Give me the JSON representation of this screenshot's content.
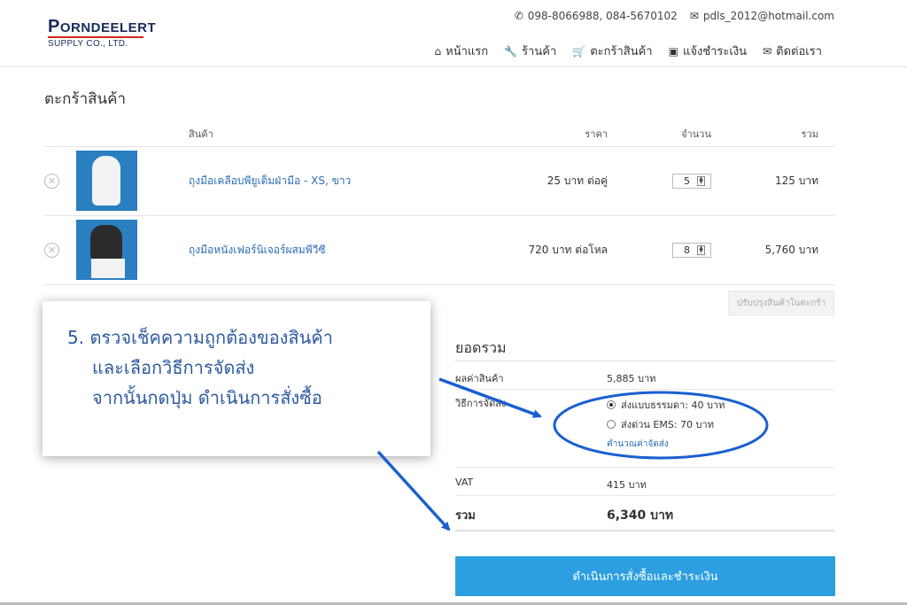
{
  "header": {
    "logo_main_first": "P",
    "logo_main_rest": "ORNDEELERT",
    "logo_sub": "SUPPLY  CO., LTD.",
    "phone": "098-8066988, 084-5670102",
    "email": "pdls_2012@hotmail.com",
    "nav": [
      {
        "label": "หน้าแรก",
        "icon": "home-icon"
      },
      {
        "label": "ร้านค้า",
        "icon": "wrench-icon"
      },
      {
        "label": "ตะกร้าสินค้า",
        "icon": "basket-icon"
      },
      {
        "label": "แจ้งชำระเงิน",
        "icon": "money-icon"
      },
      {
        "label": "ติดต่อเรา",
        "icon": "envelope-open-icon"
      }
    ]
  },
  "page_title": "ตะกร้าสินค้า",
  "cart": {
    "columns": {
      "product": "สินค้า",
      "price": "ราคา",
      "qty": "จำนวน",
      "total": "รวม"
    },
    "items": [
      {
        "name": "ถุงมือเคลือบพียูเต็มฝ่ามือ - XS, ขาว",
        "price": "25 บาท ต่อคู่",
        "qty": "5",
        "total": "125 บาท"
      },
      {
        "name": "ถุงมือหนังเฟอร์นิเจอร์ผสมพีวีซี",
        "price": "720 บาท ต่อโหล",
        "qty": "8",
        "total": "5,760 บาท"
      }
    ],
    "update_label": "ปรับปรุงสินค้าในตะกร้า"
  },
  "summary": {
    "title": "ยอดรวม",
    "subtotal_label": "ผลค่าสินค้า",
    "subtotal_value": "5,885 บาท",
    "shipping_label": "วิธีการจัดส่ง",
    "shipping_options": [
      "ส่งแบบธรรมดา: 40 บาท",
      "ส่งด่วน EMS: 70 บาท"
    ],
    "calc_shipping": "คำนวณค่าจัดส่ง",
    "vat_label": "VAT",
    "vat_value": "415 บาท",
    "total_label": "รวม",
    "total_value": "6,340 บาท"
  },
  "checkout_label": "ดำเนินการสั่งซื้อและชำระเงิน",
  "callout": {
    "line1": "5.  ตรวจเช็คความถูกต้องของสินค้า",
    "line2": "และเลือกวิธีการจัดส่ง",
    "line3": "จากนั้นกดปุ่ม  ดำเนินการสั่งซื้อ"
  },
  "colors": {
    "accent": "#2c9fe0",
    "link": "#2a6db5",
    "annotation": "#1a5fd0"
  }
}
